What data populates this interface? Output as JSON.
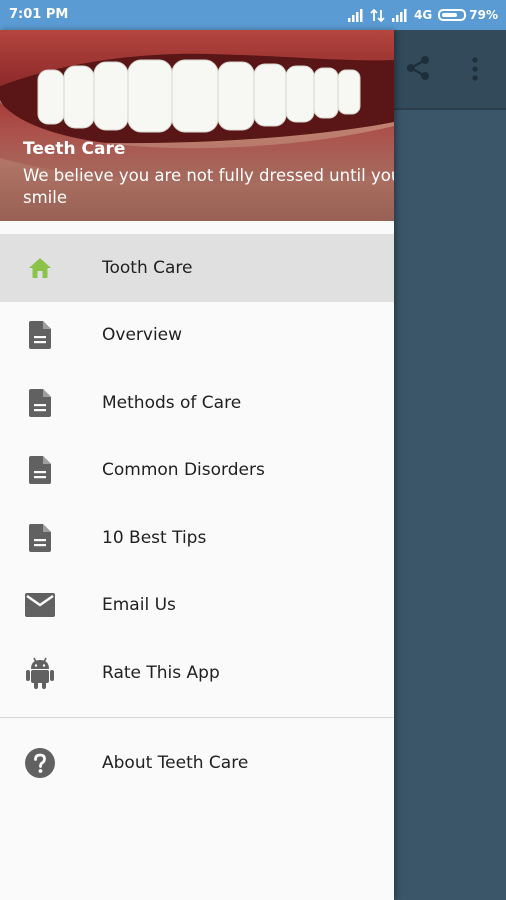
{
  "status_bar": {
    "time": "7:01 PM",
    "network": "4G",
    "battery": "79%",
    "battery_level": 0.79
  },
  "app_bar": {
    "share_icon": "share-icon",
    "more_icon": "more-vert-icon"
  },
  "drawer": {
    "header": {
      "title": "Teeth Care",
      "subtitle": "We believe you are not fully dressed until you smile"
    },
    "items": [
      {
        "label": "Tooth Care",
        "icon": "home-icon",
        "active": true
      },
      {
        "label": "Overview",
        "icon": "document-icon"
      },
      {
        "label": "Methods of Care",
        "icon": "document-icon"
      },
      {
        "label": "Common Disorders",
        "icon": "document-icon"
      },
      {
        "label": "10 Best Tips",
        "icon": "document-icon"
      },
      {
        "label": "Email Us",
        "icon": "email-icon"
      },
      {
        "label": "Rate This App",
        "icon": "android-icon"
      }
    ],
    "secondary_items": [
      {
        "label": "About Teeth Care",
        "icon": "help-icon"
      }
    ]
  },
  "colors": {
    "status_bar": "#5b9bd3",
    "scrim": "#3b5668",
    "active_item_bg": "#e0e0e0",
    "active_icon": "#8bc34a",
    "icon_gray": "#616161"
  }
}
